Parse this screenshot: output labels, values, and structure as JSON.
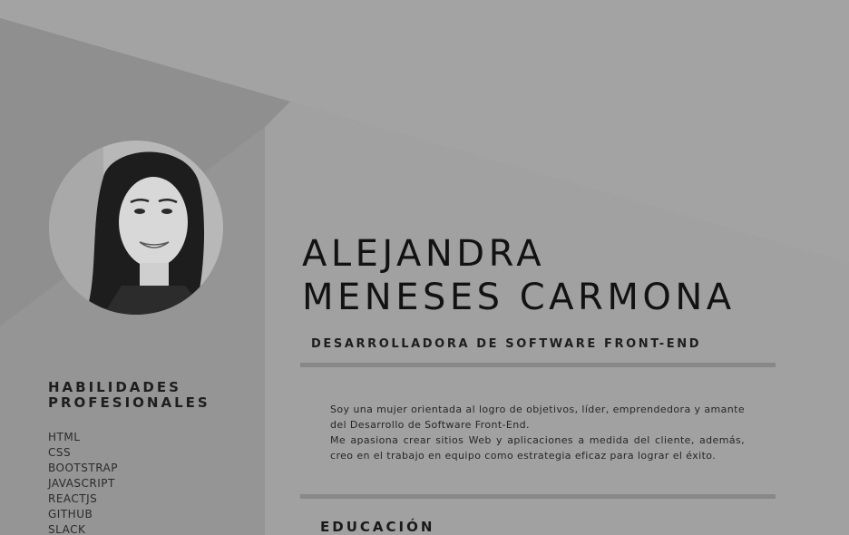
{
  "profile": {
    "name_line1": "ALEJANDRA",
    "name_line2": "MENESES CARMONA",
    "role": "DESARROLLADORA DE SOFTWARE FRONT-END",
    "photo_alt": "Foto de perfil"
  },
  "skills": {
    "title_line1": "HABILIDADES",
    "title_line2": "PROFESIONALES",
    "items": [
      "HTML",
      "CSS",
      "BOOTSTRAP",
      "JAVASCRIPT",
      "REACTJS",
      "GITHUB",
      "SLACK"
    ]
  },
  "about": {
    "paragraph1": "Soy una mujer orientada al logro de objetivos, líder, emprendedora y amante del Desarrollo de Software Front-End.",
    "paragraph2": "Me apasiona crear sitios Web y aplicaciones a medida del cliente, además, creo en el trabajo en equipo como estrategia eficaz para lograr el éxito."
  },
  "education": {
    "title": "EDUCACIÓN"
  },
  "colors": {
    "background": "#9c9c9c",
    "text": "#121212",
    "rule": "#888888"
  }
}
